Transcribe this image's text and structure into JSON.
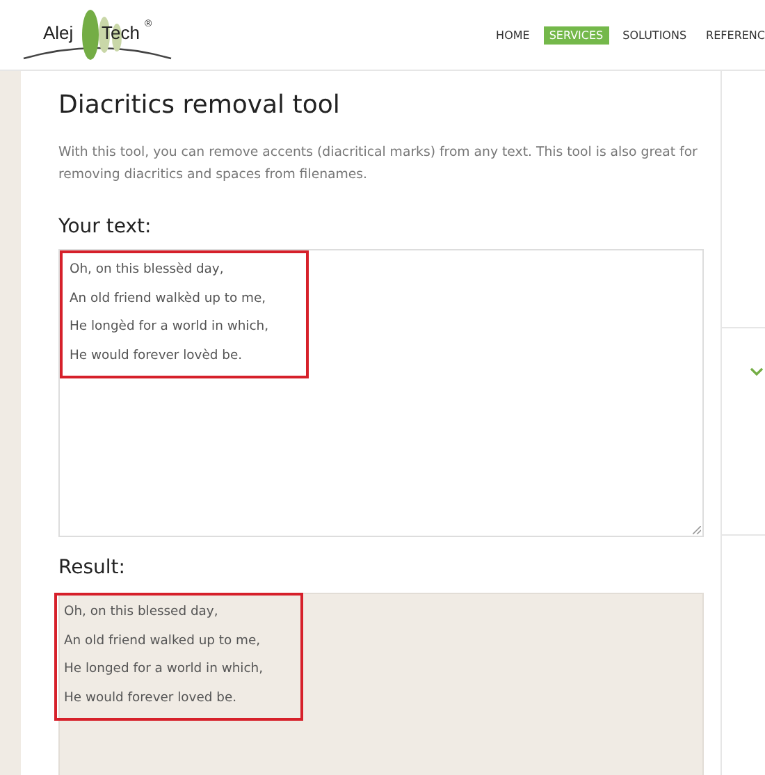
{
  "logo": {
    "left": "Alej",
    "right": "Tech",
    "mark": "®"
  },
  "nav": [
    {
      "label": "HOME",
      "selected": false
    },
    {
      "label": "SERVICES",
      "selected": true
    },
    {
      "label": "SOLUTIONS",
      "selected": false
    },
    {
      "label": "REFERENC",
      "selected": false
    }
  ],
  "title": "Diacritics removal tool",
  "description": "With this tool, you can remove accents (diacritical marks) from any text. This tool is also great for removing diacritics and spaces from filenames.",
  "input": {
    "label": "Your text:",
    "lines": [
      "Oh, on this blessèd day,",
      "An old friend walkèd up to me,",
      "He longèd for a world in which,",
      "He would forever lovèd be."
    ]
  },
  "result": {
    "label": "Result:",
    "lines": [
      "Oh, on this blessed day,",
      "An old friend walked up to me,",
      "He longed for a world in which,",
      "He would forever loved be."
    ]
  }
}
